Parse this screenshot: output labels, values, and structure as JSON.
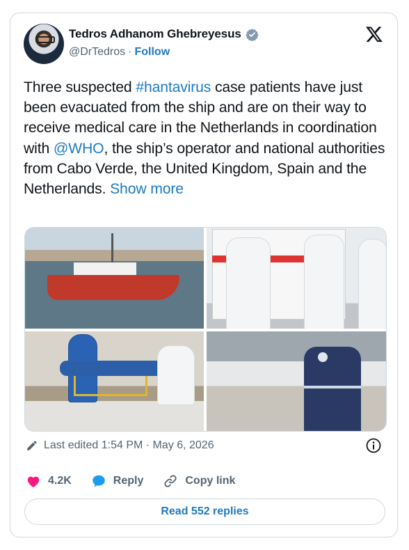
{
  "author": {
    "name": "Tedros Adhanom Ghebreyesus",
    "handle": "@DrTedros",
    "separator": "·",
    "follow_label": "Follow"
  },
  "tweet": {
    "text_1": "Three suspected ",
    "hashtag": "#hantavirus",
    "text_2": " case patients have just been evacuated from the ship and are on their way to receive medical care in the Netherlands in coordination with ",
    "mention": "@WHO",
    "text_3": ", the ship’s operator and national authorities from Cabo Verde, the United Kingdom, Spain and the Netherlands. ",
    "show_more": "Show more"
  },
  "photos": [
    {
      "label": "boat-photo"
    },
    {
      "label": "ambulance-photo"
    },
    {
      "label": "stretcher-photo"
    },
    {
      "label": "who-worker-photo"
    }
  ],
  "meta": {
    "edited_text": "Last edited 1:54 PM · May 6, 2026"
  },
  "actions": {
    "likes": "4.2K",
    "reply_label": "Reply",
    "copy_link_label": "Copy link",
    "read_replies_label": "Read 552 replies"
  },
  "colors": {
    "accent": "#1d7ac2",
    "like": "#f91880",
    "text": "#0f1419",
    "muted": "#536471",
    "border": "#cfd9de"
  }
}
